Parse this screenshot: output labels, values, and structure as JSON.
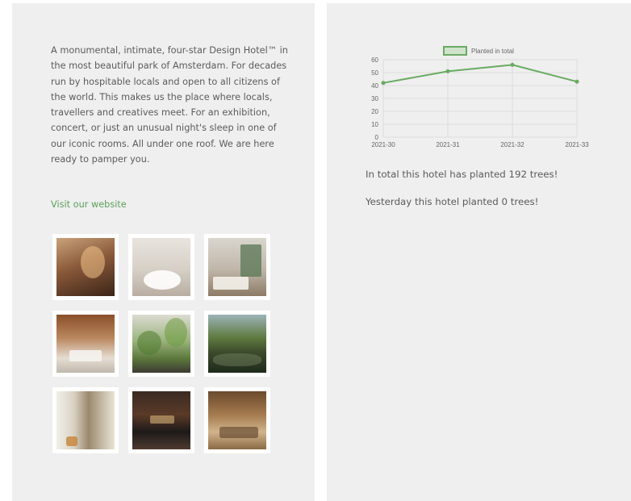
{
  "hotel": {
    "description": "A monumental, intimate, four-star Design Hotel™ in the most beautiful park of Amsterdam. For decades run by hospitable locals and open to all citizens of the world. This makes us the place where locals, travellers and creatives meet. For an exhibition, concert, or just an unusual night's sleep in one of our iconic rooms. All under one roof. We are here ready to pamper you.",
    "website_link": "Visit our website",
    "gallery": [
      {
        "name": "photo-building-entrance"
      },
      {
        "name": "photo-bathroom-bathtub"
      },
      {
        "name": "photo-bedroom-green"
      },
      {
        "name": "photo-attic-room-beams"
      },
      {
        "name": "photo-lobby-plants"
      },
      {
        "name": "photo-park-pond"
      },
      {
        "name": "photo-bookshelf-lounge"
      },
      {
        "name": "photo-dark-event-hall"
      },
      {
        "name": "photo-meeting-room"
      }
    ]
  },
  "stats": {
    "total_text": "In total this hotel has planted 192 trees!",
    "yesterday_text": "Yesterday this hotel planted 0 trees!"
  },
  "chart_data": {
    "type": "line",
    "categories": [
      "2021-30",
      "2021-31",
      "2021-32",
      "2021-33"
    ],
    "series": [
      {
        "name": "Planted in total",
        "values": [
          42,
          51,
          56,
          43
        ]
      }
    ],
    "title": "",
    "xlabel": "",
    "ylabel": "",
    "ylim": [
      0,
      60
    ],
    "yticks": [
      0,
      10,
      20,
      30,
      40,
      50,
      60
    ],
    "grid": true,
    "legend": "top-center",
    "colors": {
      "line": "#6aaa64",
      "fill": "#cfe3cb",
      "grid": "#dcdcdc",
      "tick": "#666666"
    }
  }
}
